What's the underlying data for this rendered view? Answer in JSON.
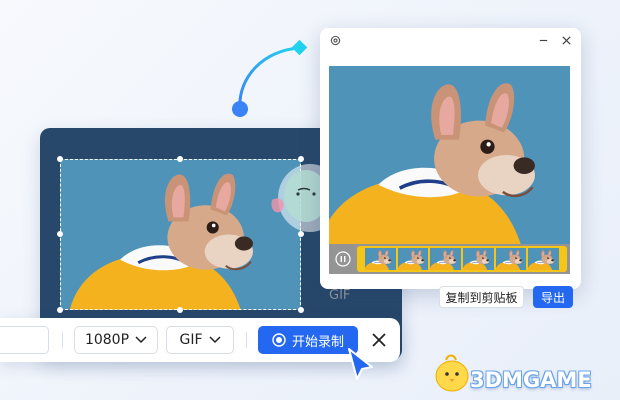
{
  "toolbar": {
    "resolution": "1080P",
    "format": "GIF",
    "record_label": "开始录制"
  },
  "preview": {
    "format_label": "GIF",
    "copy_label": "复制到剪贴板",
    "export_label": "导出"
  },
  "watermark": "3DMGAME",
  "colors": {
    "accent": "#2468f2",
    "cursor": "#2468f2",
    "connector_start": "#3b82f6",
    "connector_end": "#22d3ee",
    "filmstrip_frame": "#f5c518",
    "photo_bg": "#4f93b9",
    "hoodie": "#f4b21f"
  },
  "icons": [
    "settings-icon",
    "minimize-icon",
    "close-icon",
    "chevron-down-icon",
    "record-icon",
    "pause-icon",
    "cursor-arrow-icon",
    "mascot-icon"
  ]
}
